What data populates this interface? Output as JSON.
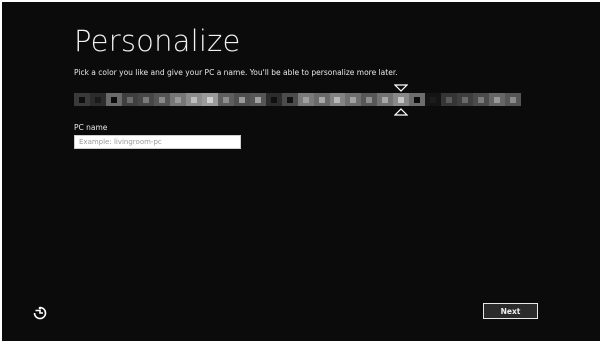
{
  "page": {
    "title": "Personalize",
    "instructions": "Pick a color you like and give your PC a name. You'll be able to personalize more later."
  },
  "color_picker": {
    "swatches": [
      {
        "bg": "#3a3a3a",
        "dot": "#0e0e0e"
      },
      {
        "bg": "#2c2c2c",
        "dot": "#1a1a1a"
      },
      {
        "bg": "#6a6a6a",
        "dot": "#0a0a0a"
      },
      {
        "bg": "#3f3f3f",
        "dot": "#6b6b6b"
      },
      {
        "bg": "#474747",
        "dot": "#7a7a7a"
      },
      {
        "bg": "#555555",
        "dot": "#8a8a8a"
      },
      {
        "bg": "#767676",
        "dot": "#9a9a9a"
      },
      {
        "bg": "#8c8c8c",
        "dot": "#bdbdbd"
      },
      {
        "bg": "#9a9a9a",
        "dot": "#d0d0d0"
      },
      {
        "bg": "#5e5e5e",
        "dot": "#8e8e8e"
      },
      {
        "bg": "#4f4f4f",
        "dot": "#9a9a9a"
      },
      {
        "bg": "#565656",
        "dot": "#a2a2a2"
      },
      {
        "bg": "#2c2c2c",
        "dot": "#0f0f0f"
      },
      {
        "bg": "#4c4c4c",
        "dot": "#111111"
      },
      {
        "bg": "#7a7a7a",
        "dot": "#9e9e9e"
      },
      {
        "bg": "#6a6a6a",
        "dot": "#a9a9a9"
      },
      {
        "bg": "#838383",
        "dot": "#b8b8b8"
      },
      {
        "bg": "#6f6f6f",
        "dot": "#a3a3a3"
      },
      {
        "bg": "#575757",
        "dot": "#8f8f8f"
      },
      {
        "bg": "#727272",
        "dot": "#a8a8a8"
      },
      {
        "bg": "#888888",
        "dot": "#c6c6c6"
      },
      {
        "bg": "#6d6d6d",
        "dot": "#0b0b0b"
      },
      {
        "bg": "#141414",
        "dot": "#1c1c1c"
      },
      {
        "bg": "#353535",
        "dot": "#5a5a5a"
      },
      {
        "bg": "#3e3e3e",
        "dot": "#6a6a6a"
      },
      {
        "bg": "#4b4b4b",
        "dot": "#7c7c7c"
      },
      {
        "bg": "#666666",
        "dot": "#9a9a9a"
      },
      {
        "bg": "#555555",
        "dot": "#8a8a8a"
      }
    ],
    "selected_index": 20
  },
  "pc_name": {
    "label": "PC name",
    "placeholder": "Example: livingroom-pc",
    "value": ""
  },
  "footer": {
    "ease_of_access_icon": "ease-of-access-icon",
    "next_label": "Next"
  }
}
